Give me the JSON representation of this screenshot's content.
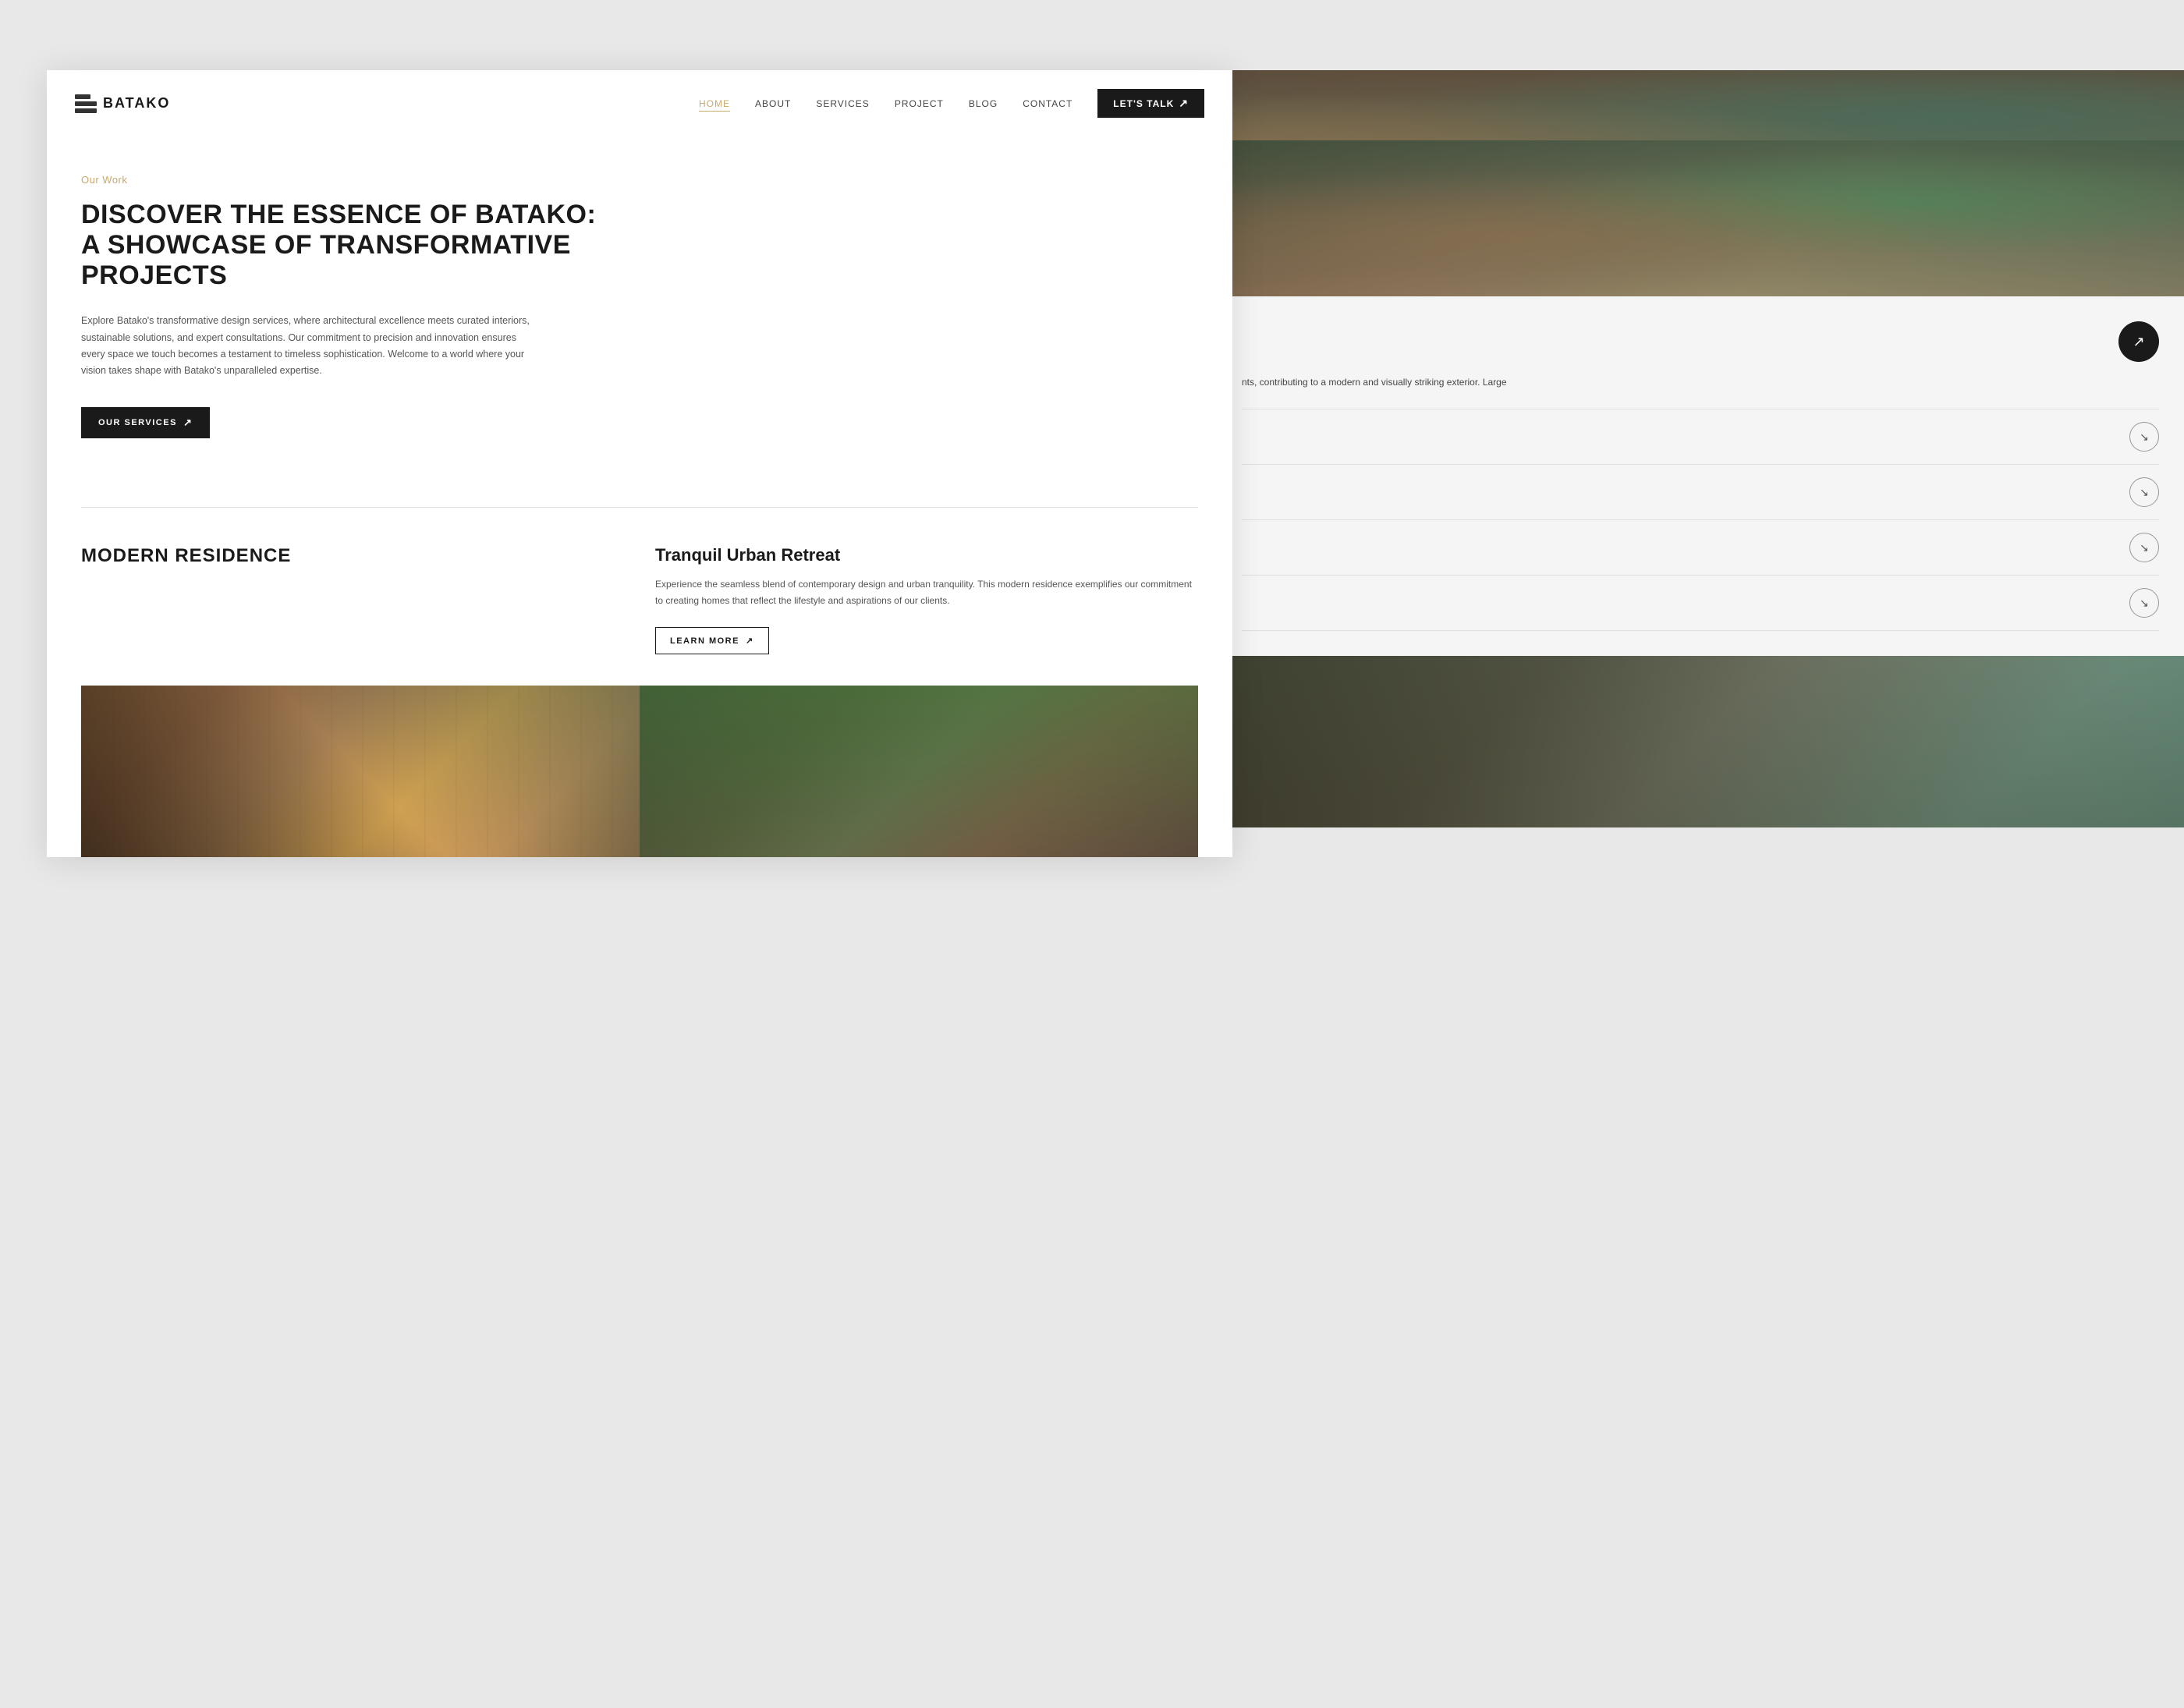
{
  "brand": {
    "name": "BATAKO",
    "logo_alt": "Batako Logo"
  },
  "navbar": {
    "links": [
      {
        "label": "HOME",
        "active": true
      },
      {
        "label": "ABOUT",
        "active": false
      },
      {
        "label": "SERVICES",
        "active": false
      },
      {
        "label": "PROJECT",
        "active": false
      },
      {
        "label": "BLOG",
        "active": false
      },
      {
        "label": "CONTACT",
        "active": false
      }
    ],
    "cta_label": "LET'S TALK",
    "cta_arrow": "↗"
  },
  "hero": {
    "eyebrow": "Our Work",
    "heading_line1": "DISCOVER THE ESSENCE OF BATAKO:",
    "heading_line2": "A SHOWCASE OF TRANSFORMATIVE",
    "heading_line3": "PROJECTS",
    "description": "Explore Batako's transformative design services, where architectural excellence meets curated interiors, sustainable solutions, and expert consultations. Our commitment to precision and innovation ensures every space we touch becomes a testament to timeless sophistication. Welcome to a world where your vision takes shape with Batako's unparalleled expertise.",
    "services_btn": "OUR SERVICES",
    "services_btn_arrow": "↗"
  },
  "residence": {
    "title": "MODERN RESIDENCE",
    "retreat_title": "Tranquil Urban Retreat",
    "retreat_description": "Experience the seamless blend of contemporary design and urban tranquility. This modern residence exemplifies our commitment to creating homes that reflect the lifestyle and aspirations of our clients.",
    "learn_more_label": "LEARN MORE",
    "learn_more_arrow": "↗"
  },
  "right_panel": {
    "description_text": "nts, contributing to a modern and visually striking exterior. Large",
    "arrow": "↗",
    "projects": [
      {
        "label": ""
      },
      {
        "label": ""
      },
      {
        "label": ""
      },
      {
        "label": ""
      }
    ],
    "outline_arrow": "↘"
  }
}
